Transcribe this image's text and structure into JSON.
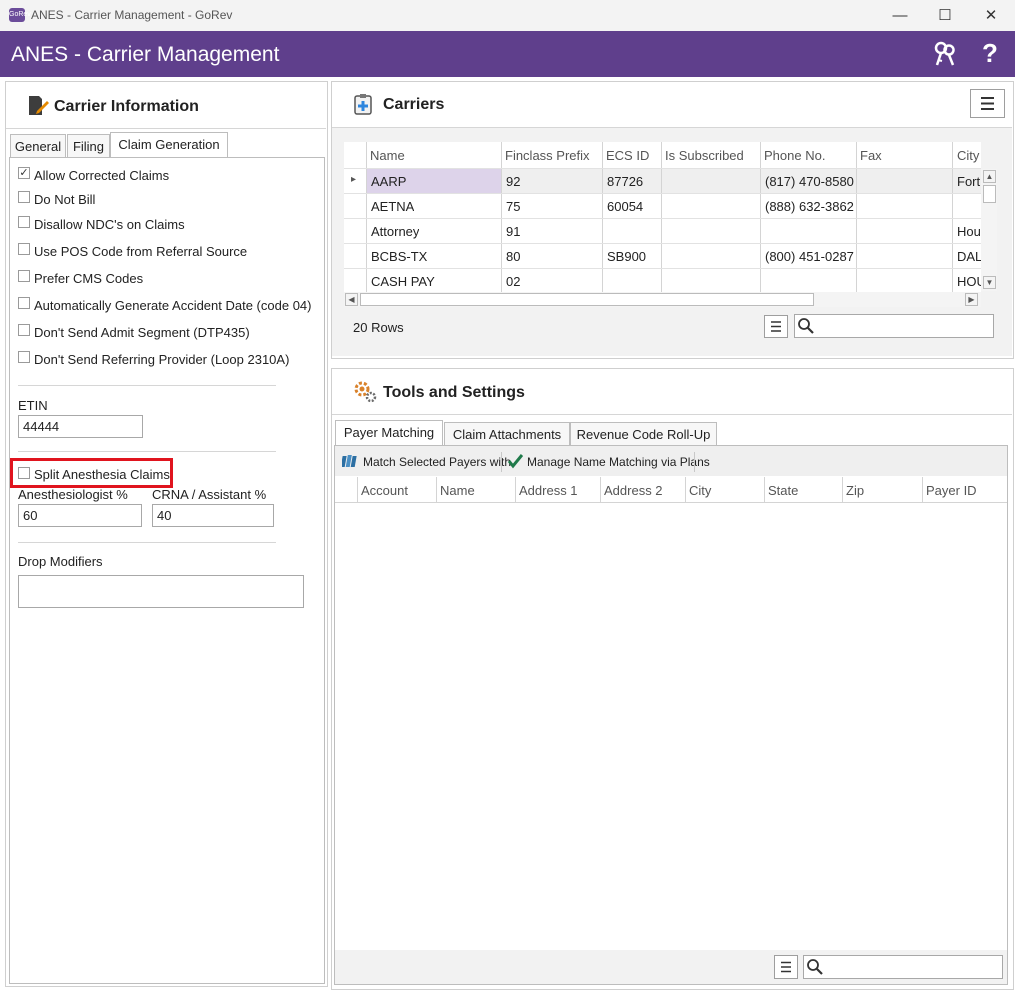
{
  "window": {
    "title": "ANES - Carrier Management - GoRev",
    "app_icon_text": "GoRev",
    "minimize": "—",
    "maximize": "☐",
    "close": "✕"
  },
  "header": {
    "title": "ANES - Carrier Management",
    "help": "?",
    "icons": [
      "keys-icon",
      "help-icon"
    ]
  },
  "carrier_info": {
    "heading": "Carrier Information",
    "tabs": [
      "General",
      "Filing",
      "Claim Generation"
    ],
    "active_tab": "Claim Generation",
    "checkboxes": [
      {
        "label": "Allow Corrected Claims",
        "checked": true,
        "mark": "✓"
      },
      {
        "label": "Do Not Bill",
        "checked": false,
        "mark": ""
      },
      {
        "label": "Disallow NDC's on Claims",
        "checked": false,
        "mark": ""
      },
      {
        "label": "Use POS Code from Referral Source",
        "checked": false,
        "mark": ""
      },
      {
        "label": "Prefer CMS Codes",
        "checked": false,
        "mark": ""
      },
      {
        "label": "Automatically Generate Accident Date (code 04)",
        "checked": false,
        "mark": ""
      },
      {
        "label": "Don't Send Admit Segment (DTP435)",
        "checked": false,
        "mark": ""
      },
      {
        "label": "Don't Send Referring Provider (Loop 2310A)",
        "checked": false,
        "mark": ""
      }
    ],
    "etin_label": "ETIN",
    "etin_value": "44444",
    "split_label": "Split Anesthesia Claims",
    "split_checked": false,
    "highlight_color": "#e0141e",
    "anesthesiologist_label": "Anesthesiologist %",
    "anesthesiologist_value": "60",
    "crna_label": "CRNA / Assistant %",
    "crna_value": "40",
    "drop_modifiers_label": "Drop Modifiers",
    "drop_modifiers_value": ""
  },
  "carriers": {
    "heading": "Carriers",
    "columns": [
      "Name",
      "Finclass Prefix",
      "ECS ID",
      "Is Subscribed",
      "Phone No.",
      "Fax",
      "City"
    ],
    "rows": [
      [
        "AARP",
        "92",
        "87726",
        "",
        "(817) 470-8580",
        "",
        "Fort"
      ],
      [
        "AETNA",
        "75",
        "60054",
        "",
        "(888) 632-3862",
        "",
        ""
      ],
      [
        "Attorney",
        "91",
        "",
        "",
        "",
        "",
        "Hou"
      ],
      [
        "BCBS-TX",
        "80",
        "SB900",
        "",
        "(800) 451-0287",
        "",
        "DAL"
      ],
      [
        "CASH PAY",
        "02",
        "",
        "",
        "",
        "",
        "HOU"
      ]
    ],
    "selected_row_index": 0,
    "selected_color": "#ddd3ea",
    "row_indicator": "▸",
    "row_count": "20 Rows",
    "search_value": ""
  },
  "tools": {
    "heading": "Tools and Settings",
    "tabs": [
      "Payer Matching",
      "Claim Attachments",
      "Revenue Code Roll-Up"
    ],
    "active_tab": "Payer Matching",
    "toolbar": {
      "match_label": "Match Selected Payers with",
      "manage_label": "Manage Name Matching via Plans"
    },
    "columns": [
      "Account",
      "Name",
      "Address 1",
      "Address 2",
      "City",
      "State",
      "Zip",
      "Payer ID"
    ],
    "search_value": ""
  },
  "colors": {
    "header": "#5f3f8c",
    "accent_check": "#1f7a4a"
  }
}
